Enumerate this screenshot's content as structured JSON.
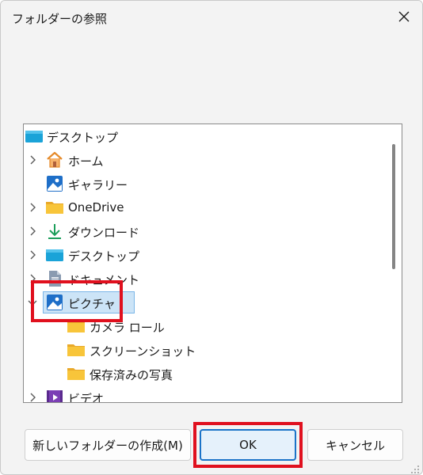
{
  "dialog": {
    "title": "フォルダーの参照",
    "close_icon": "close-icon"
  },
  "tree": {
    "root": {
      "label": "デスクトップ",
      "icon": "desktop-icon"
    },
    "items": [
      {
        "label": "ホーム",
        "icon": "home-icon",
        "chevron": "chevron-right-icon"
      },
      {
        "label": "ギャラリー",
        "icon": "gallery-icon",
        "chevron": ""
      },
      {
        "label": "OneDrive",
        "icon": "folder-icon",
        "chevron": "chevron-right-icon"
      },
      {
        "label": "ダウンロード",
        "icon": "download-icon",
        "chevron": "chevron-right-icon"
      },
      {
        "label": "デスクトップ",
        "icon": "desktop-icon",
        "chevron": "chevron-right-icon"
      },
      {
        "label": "ドキュメント",
        "icon": "document-icon",
        "chevron": "chevron-right-icon"
      },
      {
        "label": "ピクチャ",
        "icon": "pictures-icon",
        "chevron": "chevron-down-icon",
        "selected": true
      },
      {
        "label": "カメラ ロール",
        "icon": "folder-icon",
        "chevron": ""
      },
      {
        "label": "スクリーンショット",
        "icon": "folder-icon",
        "chevron": ""
      },
      {
        "label": "保存済みの写真",
        "icon": "folder-icon",
        "chevron": ""
      },
      {
        "label": "ビデオ",
        "icon": "video-icon",
        "chevron": "chevron-right-icon"
      }
    ]
  },
  "buttons": {
    "new_folder": "新しいフォルダーの作成(M)",
    "ok": "OK",
    "cancel": "キャンセル"
  },
  "colors": {
    "accent": "#1a73c8",
    "selection": "#cce4f7",
    "highlight": "#e0101e",
    "folder": "#f8c53a"
  }
}
